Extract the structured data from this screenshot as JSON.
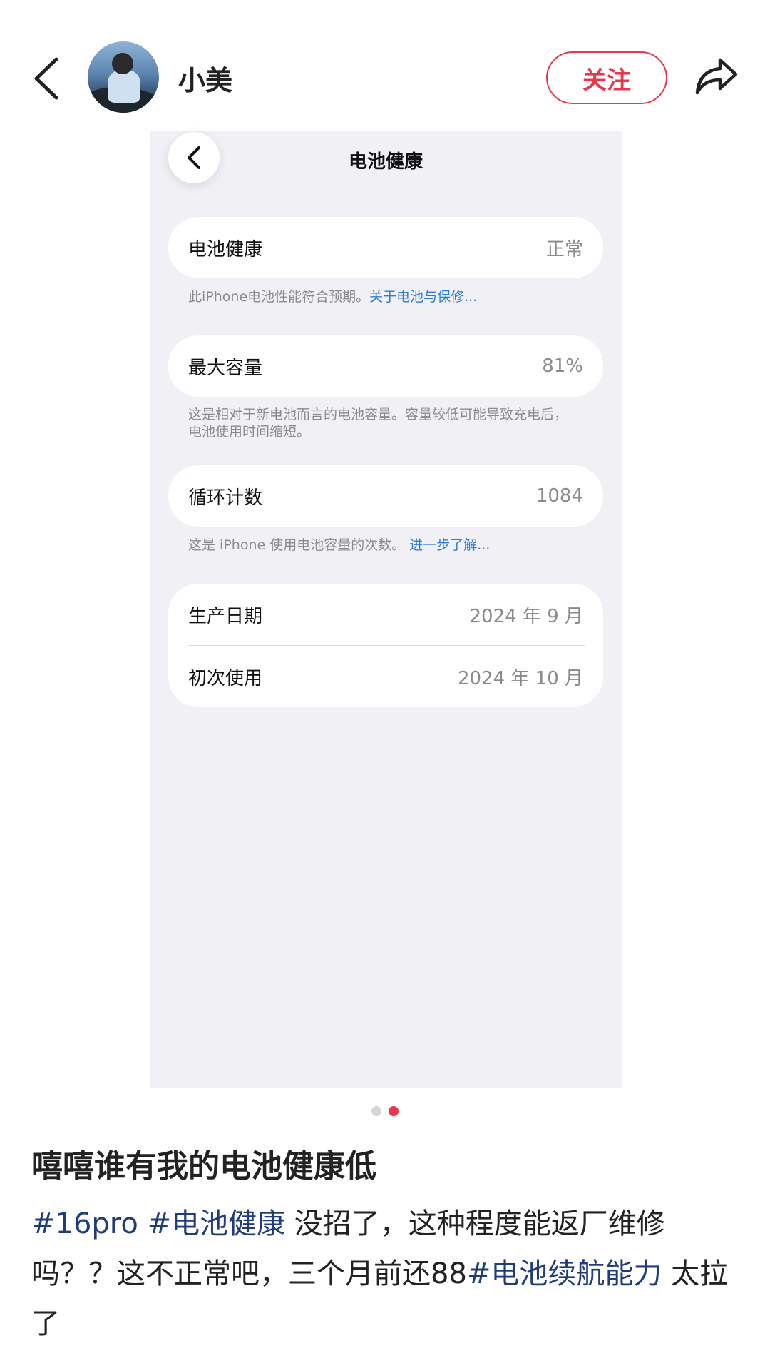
{
  "header": {
    "username": "小美",
    "follow_label": "关注"
  },
  "screenshot": {
    "title": "电池健康",
    "health": {
      "label": "电池健康",
      "value": "正常"
    },
    "health_note": {
      "text": "此iPhone电池性能符合预期。",
      "link": "关于电池与保修..."
    },
    "capacity": {
      "label": "最大容量",
      "value": "81%"
    },
    "capacity_note_line1": "这是相对于新电池而言的电池容量。容量较低可能导致充电后，",
    "capacity_note_line2": "电池使用时间缩短。",
    "cycles": {
      "label": "循环计数",
      "value": "1084"
    },
    "cycles_note": {
      "text": "这是 iPhone 使用电池容量的次数。 ",
      "link": "进一步了解..."
    },
    "manufacture": {
      "label": "生产日期",
      "value": "2024 年 9 月"
    },
    "first_use": {
      "label": "初次使用",
      "value": "2024 年 10 月"
    }
  },
  "pager": {
    "total": 2,
    "active": 2
  },
  "post": {
    "title": "嘻嘻谁有我的电池健康低",
    "tag1": "#16pro",
    "tag2": "#电池健康",
    "text1": " 没招了，这种程度能返厂维修吗？？这不正常吧，三个月前还88",
    "tag3": "#电池续航能力",
    "text2": " 太拉了"
  },
  "colors": {
    "accent": "#e8364c",
    "tag": "#203c7b",
    "link": "#2f7bd9",
    "screen_bg": "#f0f0f5"
  },
  "icons": [
    "back-arrow-icon",
    "share-icon",
    "inner-back-icon"
  ]
}
